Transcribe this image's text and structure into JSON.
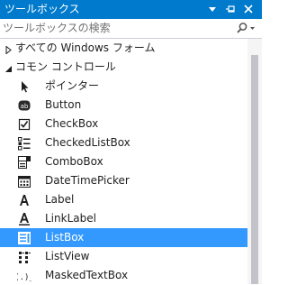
{
  "window": {
    "title": "ツールボックス",
    "icons": [
      "dropdown-arrow-icon",
      "pin-icon",
      "close-icon"
    ]
  },
  "search": {
    "placeholder": "ツールボックスの検索",
    "value": "",
    "icon": "search-icon"
  },
  "groups": [
    {
      "label": "すべての Windows フォーム",
      "expanded": false
    },
    {
      "label": "コモン コントロール",
      "expanded": true
    }
  ],
  "tools": [
    {
      "label": "ポインター",
      "icon": "pointer-icon",
      "selected": false
    },
    {
      "label": "Button",
      "icon": "button-icon",
      "selected": false
    },
    {
      "label": "CheckBox",
      "icon": "checkbox-icon",
      "selected": false
    },
    {
      "label": "CheckedListBox",
      "icon": "checked-list-box-icon",
      "selected": false
    },
    {
      "label": "ComboBox",
      "icon": "combobox-icon",
      "selected": false
    },
    {
      "label": "DateTimePicker",
      "icon": "date-time-picker-icon",
      "selected": false
    },
    {
      "label": "Label",
      "icon": "label-icon",
      "selected": false
    },
    {
      "label": "LinkLabel",
      "icon": "link-label-icon",
      "selected": false
    },
    {
      "label": "ListBox",
      "icon": "listbox-icon",
      "selected": true
    },
    {
      "label": "ListView",
      "icon": "listview-icon",
      "selected": false
    },
    {
      "label": "MaskedTextBox",
      "icon": "masked-textbox-icon",
      "selected": false
    }
  ],
  "colors": {
    "title_bar": "#007acc",
    "selection": "#3399ff",
    "scrollbar_thumb": "#c2c3c9"
  }
}
